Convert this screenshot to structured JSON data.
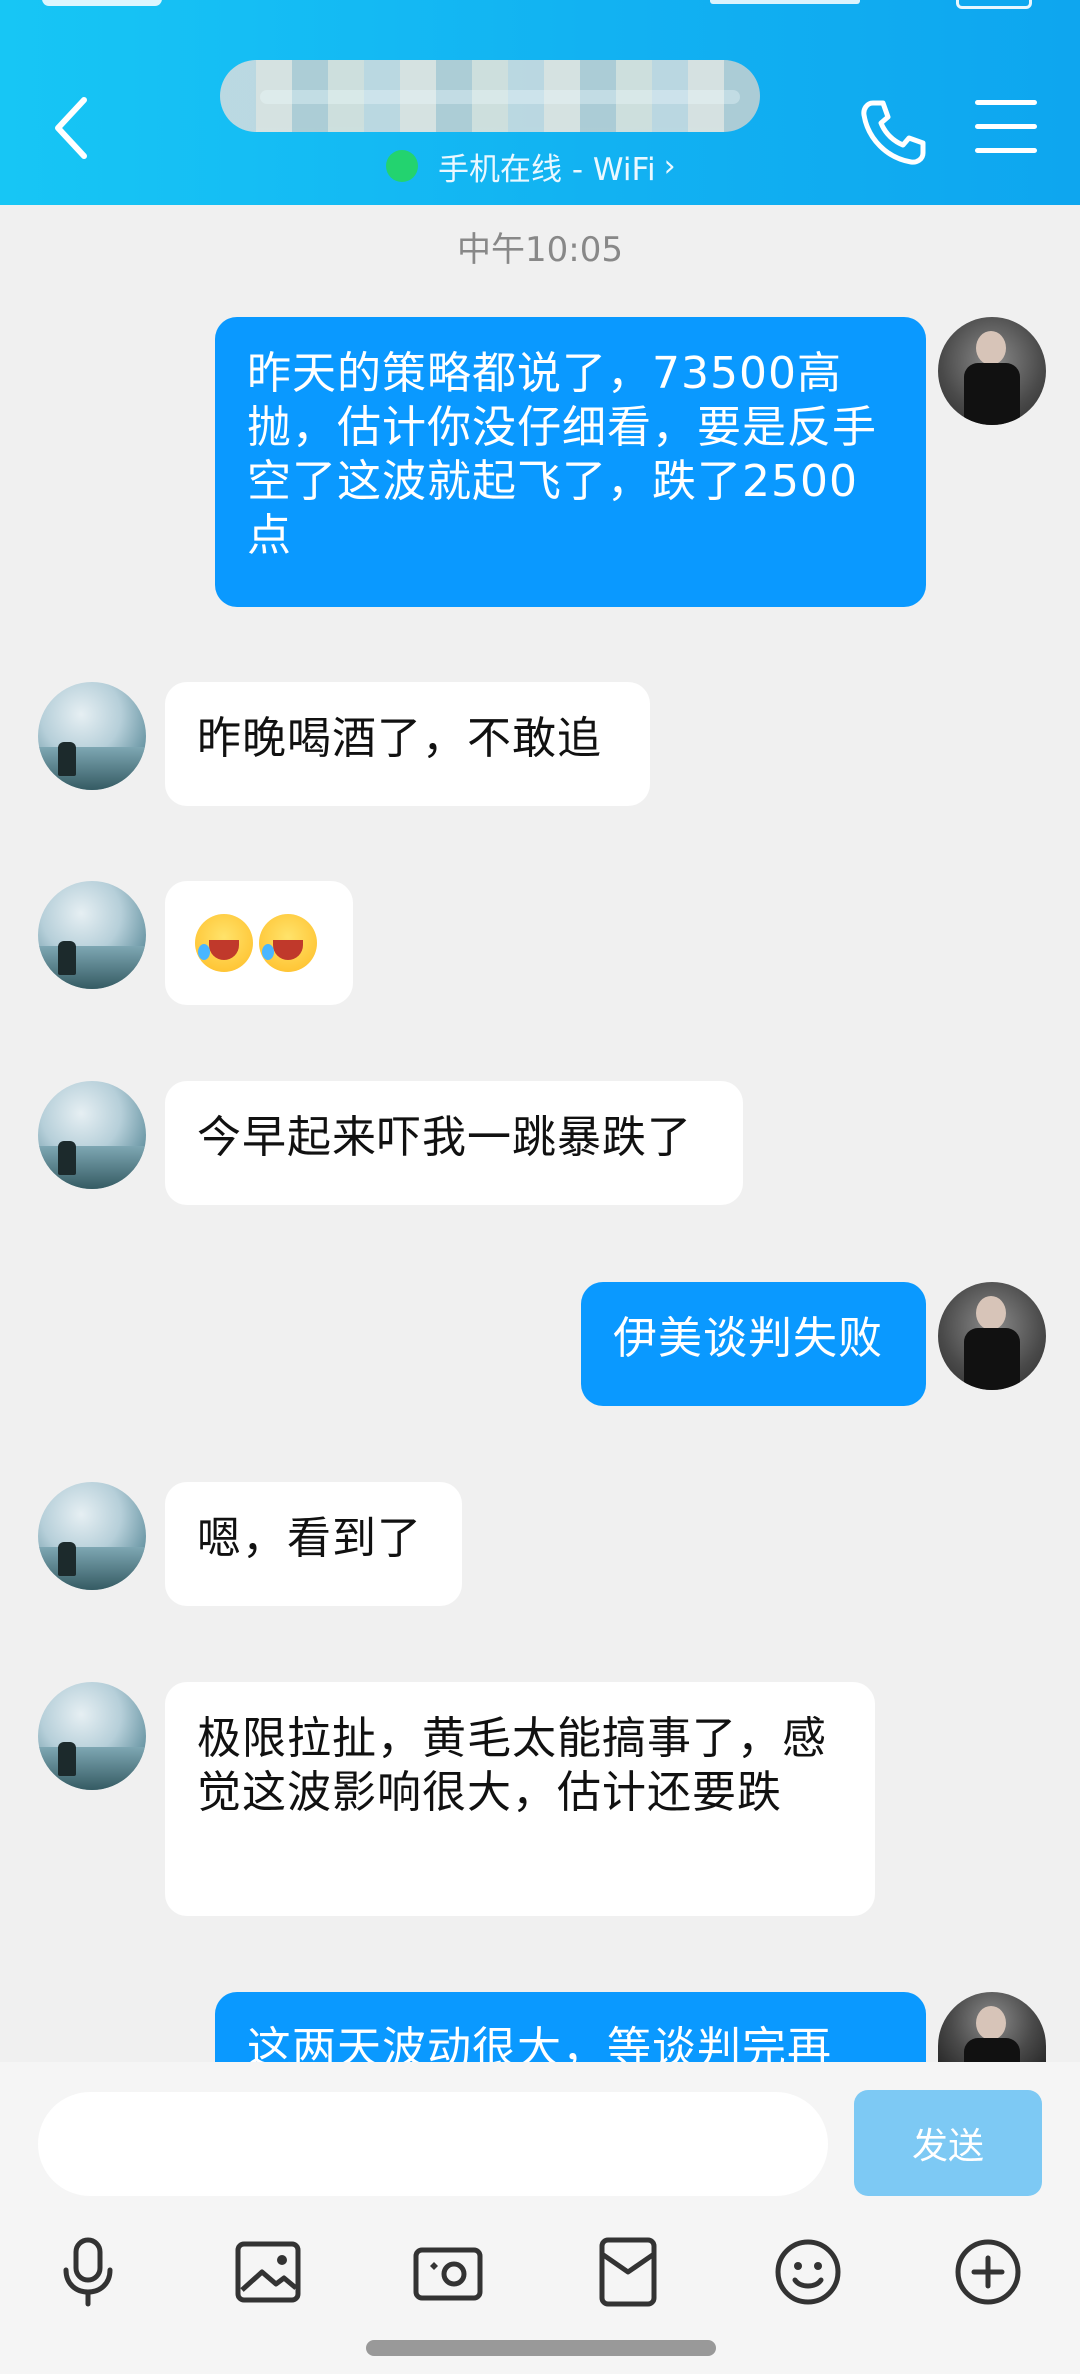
{
  "header": {
    "status": "手机在线 - WiFi",
    "chevron": "›"
  },
  "time_label": "中午10:05",
  "messages": [
    {
      "from": "me",
      "text": "昨天的策略都说了，73500高抛，估计你没仔细看，要是反手空了这波就起飞了，跌了2500点"
    },
    {
      "from": "other",
      "text": "昨晚喝酒了，不敢追"
    },
    {
      "from": "other",
      "text": "",
      "emoji_count": 2
    },
    {
      "from": "other",
      "text": "今早起来吓我一跳暴跌了"
    },
    {
      "from": "me",
      "text": "伊美谈判失败"
    },
    {
      "from": "other",
      "text": "嗯，看到了"
    },
    {
      "from": "other",
      "text": "极限拉扯，黄毛太能搞事了，感觉这波影响很大，估计还要跌"
    },
    {
      "from": "me",
      "text": "这两天波动很大，等谈判完再"
    }
  ],
  "input": {
    "placeholder": "",
    "send_label": "发送"
  },
  "toolbar": {
    "icons": [
      "microphone-icon",
      "image-icon",
      "camera-icon",
      "red-packet-icon",
      "emoji-icon",
      "plus-icon"
    ]
  },
  "colors": {
    "header": "#12b2f2",
    "bubble_me": "#0a99ff",
    "bubble_other": "#ffffff",
    "send_button": "#7dc9f4",
    "online_dot": "#23d36f"
  }
}
